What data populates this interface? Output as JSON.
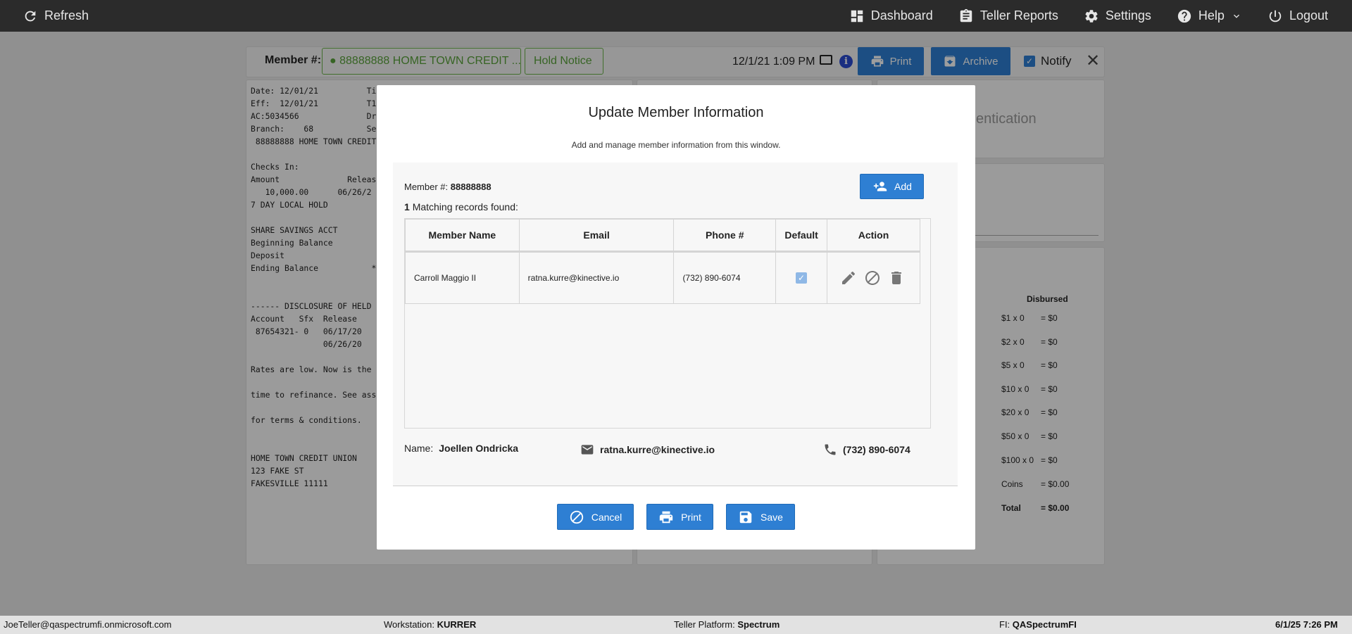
{
  "topbar": {
    "refresh_label": "Refresh",
    "nav": [
      {
        "label": "Dashboard",
        "icon": "dashboard-icon"
      },
      {
        "label": "Teller Reports",
        "icon": "clipboard-icon"
      },
      {
        "label": "Settings",
        "icon": "gear-icon"
      },
      {
        "label": "Help",
        "icon": "help-icon"
      },
      {
        "label": "Logout",
        "icon": "power-icon"
      }
    ]
  },
  "member_bar": {
    "label": "Member #:",
    "member_value": "88888888 HOME TOWN CREDIT ...",
    "hold_notice": "Hold Notice",
    "datetime": "12/1/21 1:09 PM",
    "info_glyph": "i",
    "print_label": "Print",
    "archive_label": "Archive",
    "notify_label": "Notify",
    "notify_checked": true
  },
  "receipt": {
    "lines": [
      "Date: 12/01/21          Ti",
      "Eff:  12/01/21          T1",
      "AC:5034566              Dr",
      "Branch:    68           Se",
      " 88888888 HOME TOWN CREDIT",
      "",
      "Checks In:",
      "Amount              Releas",
      "   10,000.00      06/26/2",
      "7 DAY LOCAL HOLD",
      "",
      "SHARE SAVINGS ACCT",
      "Beginning Balance",
      "Deposit",
      "Ending Balance           *",
      "",
      "",
      "------ DISCLOSURE OF HELD F",
      "Account   Sfx  Release",
      " 87654321- 0   06/17/20",
      "               06/26/20",
      "",
      "Rates are low. Now is the",
      "",
      "time to refinance. See asso",
      "",
      "for terms & conditions.",
      "",
      "",
      "HOME TOWN CREDIT UNION",
      "123 FAKE ST",
      "FAKESVILLE 11111"
    ]
  },
  "right_panel": {
    "auth_fragment": "entication",
    "disbursed_title": "Disbursed",
    "disbursed": [
      {
        "denom": "$1 x 0",
        "value": "= $0"
      },
      {
        "denom": "$2 x 0",
        "value": "= $0"
      },
      {
        "denom": "$5 x 0",
        "value": "= $0"
      },
      {
        "denom": "$10 x 0",
        "value": "= $0"
      },
      {
        "denom": "$20 x 0",
        "value": "= $0"
      },
      {
        "denom": "$50 x 0",
        "value": "= $0"
      },
      {
        "denom": "$100 x 0",
        "value": "= $0"
      },
      {
        "denom": "Coins",
        "value": "= $0.00"
      },
      {
        "denom": "Total",
        "value": "= $0.00"
      }
    ]
  },
  "modal": {
    "title": "Update Member Information",
    "subtitle": "Add and manage member information from this window.",
    "member_label": "Member #:",
    "member_number": "88888888",
    "match_count": "1",
    "match_text": "Matching records found:",
    "add_label": "Add",
    "columns": [
      "Member Name",
      "Email",
      "Phone #",
      "Default",
      "Action"
    ],
    "rows": [
      {
        "name": "Carroll Maggio II",
        "email": "ratna.kurre@kinective.io",
        "phone": "(732) 890-6074",
        "default": true
      }
    ],
    "summary": {
      "name_label": "Name:",
      "name_value": "Joellen Ondricka",
      "email_value": "ratna.kurre@kinective.io",
      "phone_value": "(732) 890-6074"
    },
    "cancel_label": "Cancel",
    "print_label": "Print",
    "save_label": "Save"
  },
  "statusbar": {
    "user": "JoeTeller@qaspectrumfi.onmicrosoft.com",
    "workstation_label": "Workstation:",
    "workstation_value": "KURRER",
    "platform_label": "Teller Platform:",
    "platform_value": "Spectrum",
    "fi_label": "FI:",
    "fi_value": "QASpectrumFI",
    "datetime": "6/1/25 7:26 PM"
  }
}
